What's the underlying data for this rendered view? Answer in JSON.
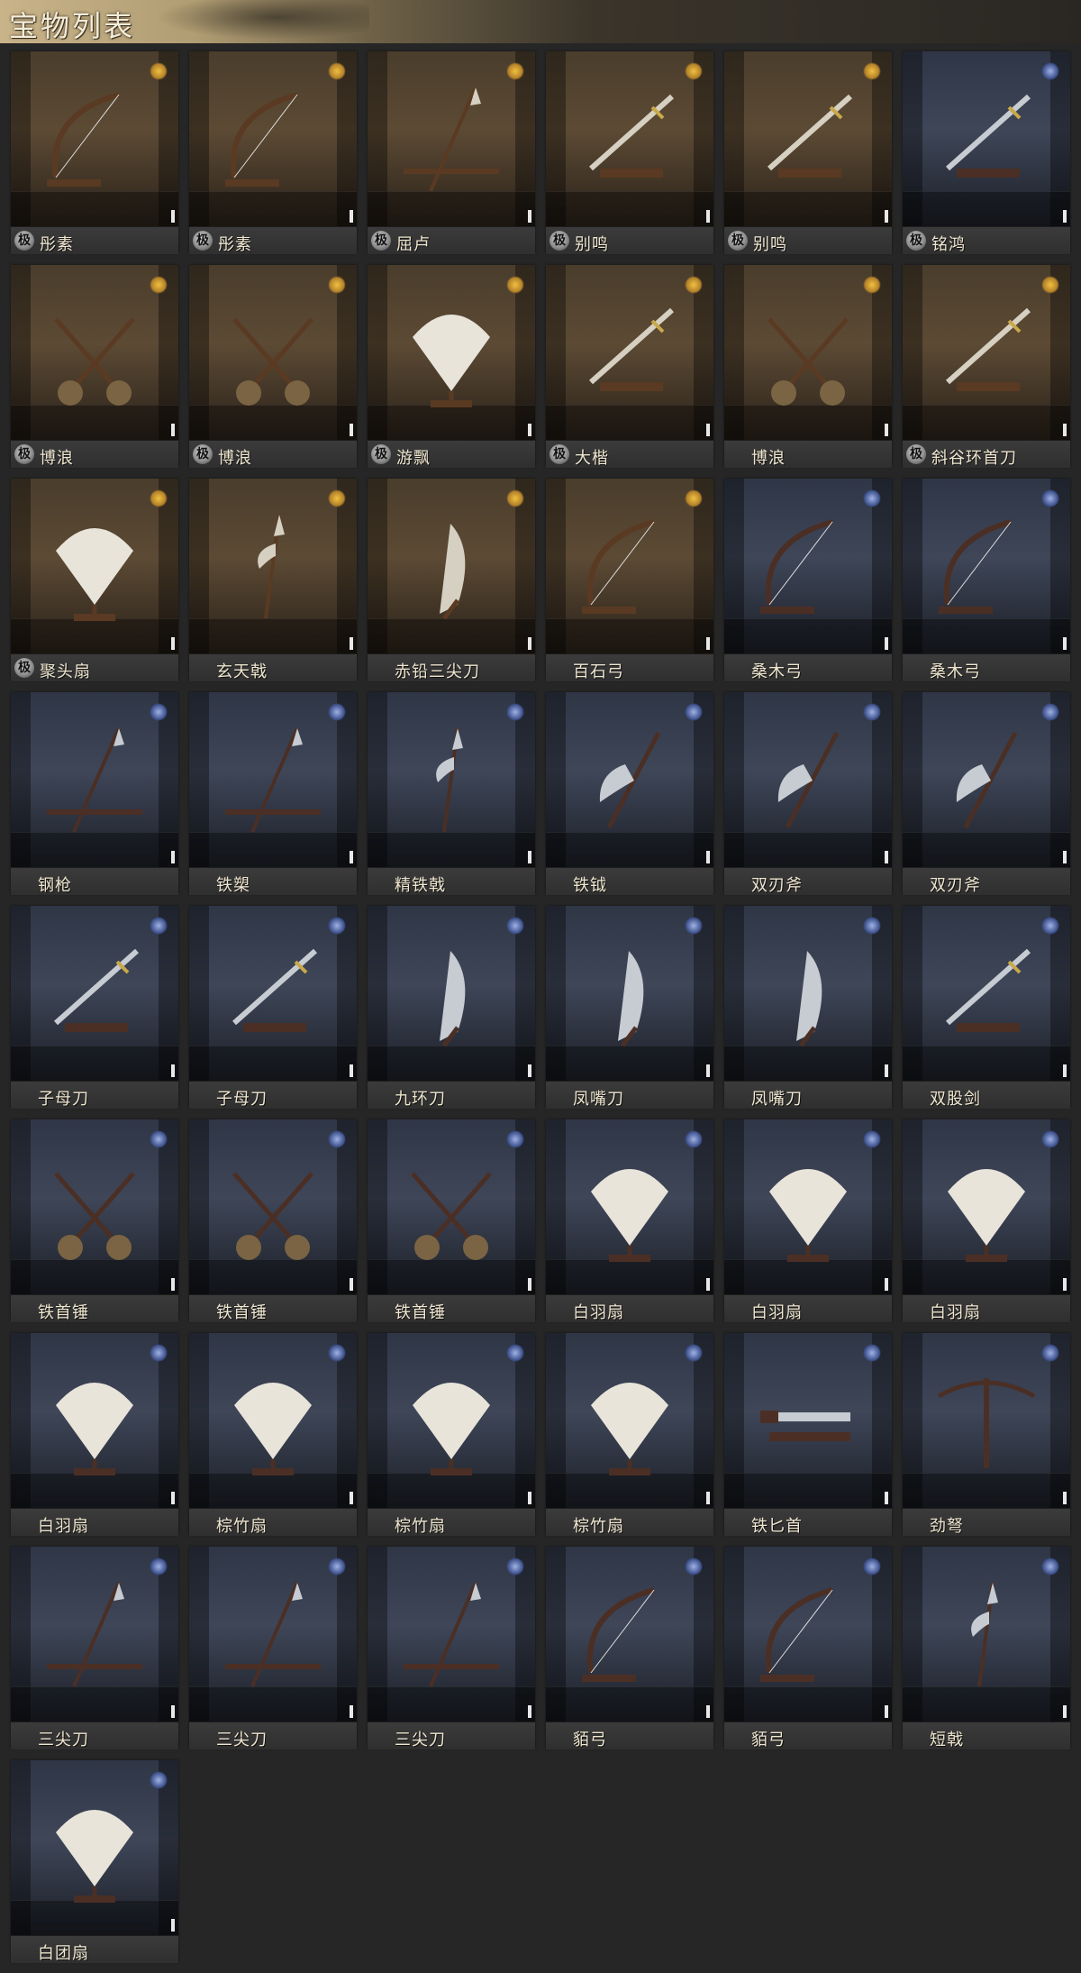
{
  "header": {
    "title": "宝物列表"
  },
  "badge_text": "极",
  "colors": {
    "brown_theme": "#5c4a34",
    "blue_theme": "#3e4658",
    "label_text": "#efe6d0"
  },
  "items": [
    {
      "name": "彤素",
      "badge": true,
      "theme": "brown",
      "icon": "bow-icon"
    },
    {
      "name": "彤素",
      "badge": true,
      "theme": "brown",
      "icon": "bow-icon"
    },
    {
      "name": "屈卢",
      "badge": true,
      "theme": "brown",
      "icon": "spear-icon"
    },
    {
      "name": "别鸣",
      "badge": true,
      "theme": "brown",
      "icon": "sword-icon"
    },
    {
      "name": "别鸣",
      "badge": true,
      "theme": "brown",
      "icon": "sword-icon"
    },
    {
      "name": "铭鸿",
      "badge": true,
      "theme": "blue",
      "icon": "sword-icon"
    },
    {
      "name": "博浪",
      "badge": true,
      "theme": "brown",
      "icon": "hammer-icon"
    },
    {
      "name": "博浪",
      "badge": true,
      "theme": "brown",
      "icon": "hammer-icon"
    },
    {
      "name": "游飘",
      "badge": true,
      "theme": "brown",
      "icon": "fan-icon"
    },
    {
      "name": "大楷",
      "badge": true,
      "theme": "brown",
      "icon": "sword-icon"
    },
    {
      "name": "博浪",
      "badge": false,
      "theme": "brown",
      "icon": "hammer-icon"
    },
    {
      "name": "斜谷环首刀",
      "badge": true,
      "theme": "brown",
      "icon": "sword-icon"
    },
    {
      "name": "聚头扇",
      "badge": true,
      "theme": "brown",
      "icon": "fan-icon"
    },
    {
      "name": "玄天戟",
      "badge": false,
      "theme": "brown",
      "icon": "halberd-icon"
    },
    {
      "name": "赤铅三尖刀",
      "badge": false,
      "theme": "brown",
      "icon": "blade-icon"
    },
    {
      "name": "百石弓",
      "badge": false,
      "theme": "brown",
      "icon": "bow-icon"
    },
    {
      "name": "桑木弓",
      "badge": false,
      "theme": "blue",
      "icon": "bow-icon"
    },
    {
      "name": "桑木弓",
      "badge": false,
      "theme": "blue",
      "icon": "bow-icon"
    },
    {
      "name": "钢枪",
      "badge": false,
      "theme": "blue",
      "icon": "spear-icon"
    },
    {
      "name": "铁槊",
      "badge": false,
      "theme": "blue",
      "icon": "spear-icon"
    },
    {
      "name": "精铁戟",
      "badge": false,
      "theme": "blue",
      "icon": "halberd-icon"
    },
    {
      "name": "铁钺",
      "badge": false,
      "theme": "blue",
      "icon": "axe-icon"
    },
    {
      "name": "双刃斧",
      "badge": false,
      "theme": "blue",
      "icon": "axe-icon"
    },
    {
      "name": "双刃斧",
      "badge": false,
      "theme": "blue",
      "icon": "axe-icon"
    },
    {
      "name": "子母刀",
      "badge": false,
      "theme": "blue",
      "icon": "sword-icon"
    },
    {
      "name": "子母刀",
      "badge": false,
      "theme": "blue",
      "icon": "sword-icon"
    },
    {
      "name": "九环刀",
      "badge": false,
      "theme": "blue",
      "icon": "blade-icon"
    },
    {
      "name": "凤嘴刀",
      "badge": false,
      "theme": "blue",
      "icon": "blade-icon"
    },
    {
      "name": "凤嘴刀",
      "badge": false,
      "theme": "blue",
      "icon": "blade-icon"
    },
    {
      "name": "双股剑",
      "badge": false,
      "theme": "blue",
      "icon": "sword-icon"
    },
    {
      "name": "铁首锤",
      "badge": false,
      "theme": "blue",
      "icon": "hammer-icon"
    },
    {
      "name": "铁首锤",
      "badge": false,
      "theme": "blue",
      "icon": "hammer-icon"
    },
    {
      "name": "铁首锤",
      "badge": false,
      "theme": "blue",
      "icon": "hammer-icon"
    },
    {
      "name": "白羽扇",
      "badge": false,
      "theme": "blue",
      "icon": "fan-icon"
    },
    {
      "name": "白羽扇",
      "badge": false,
      "theme": "blue",
      "icon": "fan-icon"
    },
    {
      "name": "白羽扇",
      "badge": false,
      "theme": "blue",
      "icon": "fan-icon"
    },
    {
      "name": "白羽扇",
      "badge": false,
      "theme": "blue",
      "icon": "fan-icon"
    },
    {
      "name": "棕竹扇",
      "badge": false,
      "theme": "blue",
      "icon": "fan-icon"
    },
    {
      "name": "棕竹扇",
      "badge": false,
      "theme": "blue",
      "icon": "fan-icon"
    },
    {
      "name": "棕竹扇",
      "badge": false,
      "theme": "blue",
      "icon": "fan-icon"
    },
    {
      "name": "铁匕首",
      "badge": false,
      "theme": "blue",
      "icon": "dagger-icon"
    },
    {
      "name": "劲弩",
      "badge": false,
      "theme": "blue",
      "icon": "crossbow-icon"
    },
    {
      "name": "三尖刀",
      "badge": false,
      "theme": "blue",
      "icon": "spear-icon"
    },
    {
      "name": "三尖刀",
      "badge": false,
      "theme": "blue",
      "icon": "spear-icon"
    },
    {
      "name": "三尖刀",
      "badge": false,
      "theme": "blue",
      "icon": "spear-icon"
    },
    {
      "name": "貊弓",
      "badge": false,
      "theme": "blue",
      "icon": "bow-icon"
    },
    {
      "name": "貊弓",
      "badge": false,
      "theme": "blue",
      "icon": "bow-icon"
    },
    {
      "name": "短戟",
      "badge": false,
      "theme": "blue",
      "icon": "halberd-icon"
    },
    {
      "name": "白团扇",
      "badge": false,
      "theme": "blue",
      "icon": "fan-icon"
    }
  ]
}
